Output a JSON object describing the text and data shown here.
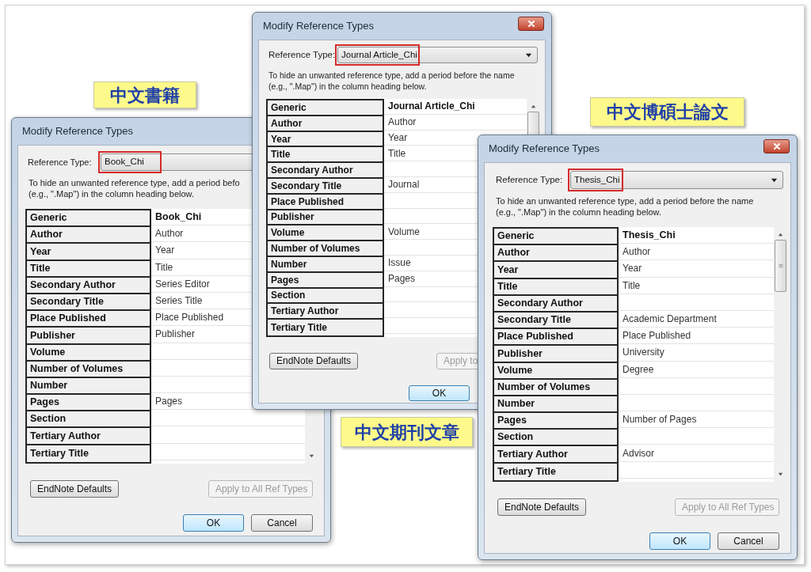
{
  "captions": [
    {
      "text": "中文書籍"
    },
    {
      "text": "中文期刊文章"
    },
    {
      "text": "中文博碩士論文"
    }
  ],
  "windows": [
    {
      "title": "Modify Reference Types",
      "reference_type": {
        "label": "Reference Type:",
        "value": "Book_Chi",
        "highlighted": true
      },
      "instructions": [
        "To hide an unwanted reference type, add a period befo",
        "(e.g., \".Map\") in the column heading below."
      ],
      "table": {
        "header": {
          "generic": "Generic",
          "value": "Book_Chi"
        },
        "rows": [
          {
            "generic": "Author",
            "value": "Author"
          },
          {
            "generic": "Year",
            "value": "Year"
          },
          {
            "generic": "Title",
            "value": "Title"
          },
          {
            "generic": "Secondary Author",
            "value": "Series Editor"
          },
          {
            "generic": "Secondary Title",
            "value": "Series Title"
          },
          {
            "generic": "Place Published",
            "value": "Place Published"
          },
          {
            "generic": "Publisher",
            "value": "Publisher"
          },
          {
            "generic": "Volume"
          },
          {
            "generic": "Number of Volumes"
          },
          {
            "generic": "Number"
          },
          {
            "generic": "Pages",
            "value": "Pages"
          },
          {
            "generic": "Section"
          },
          {
            "generic": "Tertiary Author"
          },
          {
            "generic": "Tertiary Title"
          }
        ]
      },
      "buttons": [
        {
          "label": "EndNote Defaults",
          "disabled": false
        },
        {
          "label": "Apply to All Ref Types",
          "disabled": true
        }
      ],
      "dialog_buttons": [
        {
          "label": "OK",
          "default": true
        },
        {
          "label": "Cancel",
          "default": false
        }
      ]
    },
    {
      "title": "Modify Reference Types",
      "reference_type": {
        "label": "Reference Type:",
        "value": "Journal Article_Chi",
        "highlighted": true
      },
      "instructions": [
        "To hide an unwanted reference type, add a period before the name",
        "(e.g., \".Map\") in the column heading below."
      ],
      "table": {
        "header": {
          "generic": "Generic",
          "value": "Journal Article_Chi"
        },
        "rows": [
          {
            "generic": "Author",
            "value": "Author"
          },
          {
            "generic": "Year",
            "value": "Year"
          },
          {
            "generic": "Title",
            "value": "Title"
          },
          {
            "generic": "Secondary Author"
          },
          {
            "generic": "Secondary Title",
            "value": "Journal"
          },
          {
            "generic": "Place Published"
          },
          {
            "generic": "Publisher"
          },
          {
            "generic": "Volume",
            "value": "Volume"
          },
          {
            "generic": "Number of Volumes"
          },
          {
            "generic": "Number",
            "value": "Issue"
          },
          {
            "generic": "Pages",
            "value": "Pages"
          },
          {
            "generic": "Section"
          },
          {
            "generic": "Tertiary Author"
          },
          {
            "generic": "Tertiary Title"
          }
        ]
      },
      "buttons": [
        {
          "label": "EndNote Defaults",
          "disabled": false
        },
        {
          "label": "Apply to",
          "disabled": true
        }
      ],
      "dialog_buttons": [
        {
          "label": "OK",
          "default": true
        }
      ]
    },
    {
      "title": "Modify Reference Types",
      "reference_type": {
        "label": "Reference Type:",
        "value": "Thesis_Chi",
        "highlighted": true
      },
      "instructions": [
        "To hide an unwanted reference type, add a period before the name",
        "(e.g., \".Map\") in the column heading below."
      ],
      "table": {
        "header": {
          "generic": "Generic",
          "value": "Thesis_Chi"
        },
        "rows": [
          {
            "generic": "Author",
            "value": "Author"
          },
          {
            "generic": "Year",
            "value": "Year"
          },
          {
            "generic": "Title",
            "value": "Title"
          },
          {
            "generic": "Secondary Author"
          },
          {
            "generic": "Secondary Title",
            "value": "Academic Department"
          },
          {
            "generic": "Place Published",
            "value": "Place Published"
          },
          {
            "generic": "Publisher",
            "value": "University"
          },
          {
            "generic": "Volume",
            "value": "Degree"
          },
          {
            "generic": "Number of Volumes"
          },
          {
            "generic": "Number"
          },
          {
            "generic": "Pages",
            "value": "Number of Pages"
          },
          {
            "generic": "Section"
          },
          {
            "generic": "Tertiary Author",
            "value": "Advisor"
          },
          {
            "generic": "Tertiary Title"
          }
        ]
      },
      "buttons": [
        {
          "label": "EndNote Defaults",
          "disabled": false
        },
        {
          "label": "Apply to All Ref Types",
          "disabled": true
        }
      ],
      "dialog_buttons": [
        {
          "label": "OK",
          "default": true
        },
        {
          "label": "Cancel",
          "default": false
        }
      ]
    }
  ]
}
